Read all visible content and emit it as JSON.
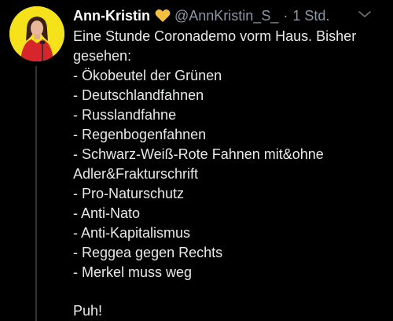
{
  "tweet": {
    "author": {
      "display_name": "Ann-Kristin",
      "badge_icon": "yellow-heart-icon",
      "handle": "@AnnKristin_S_",
      "separator": "·",
      "time": "1 Std."
    },
    "menu_icon": "chevron-down-icon",
    "body": {
      "line1": "Eine Stunde Coronademo vorm Haus. Bisher",
      "line2": "gesehen:",
      "items": [
        "- Ökobeutel der Grünen",
        "- Deutschlandfahnen",
        "- Russlandfahne",
        "- Regenbogenfahnen",
        "- Schwarz-Weiß-Rote Fahnen mit&ohne",
        "Adler&Frakturschrift",
        "- Pro-Naturschutz",
        "- Anti-Nato",
        "- Anti-Kapitalismus",
        "- Reggea gegen Rechts",
        "- Merkel muss weg"
      ],
      "closing": "Puh!"
    }
  },
  "colors": {
    "background": "#000000",
    "text": "#e7e9ea",
    "secondary_text": "#8b98a5",
    "avatar_bg": "#f6e21a",
    "heart": "#f5c040"
  }
}
